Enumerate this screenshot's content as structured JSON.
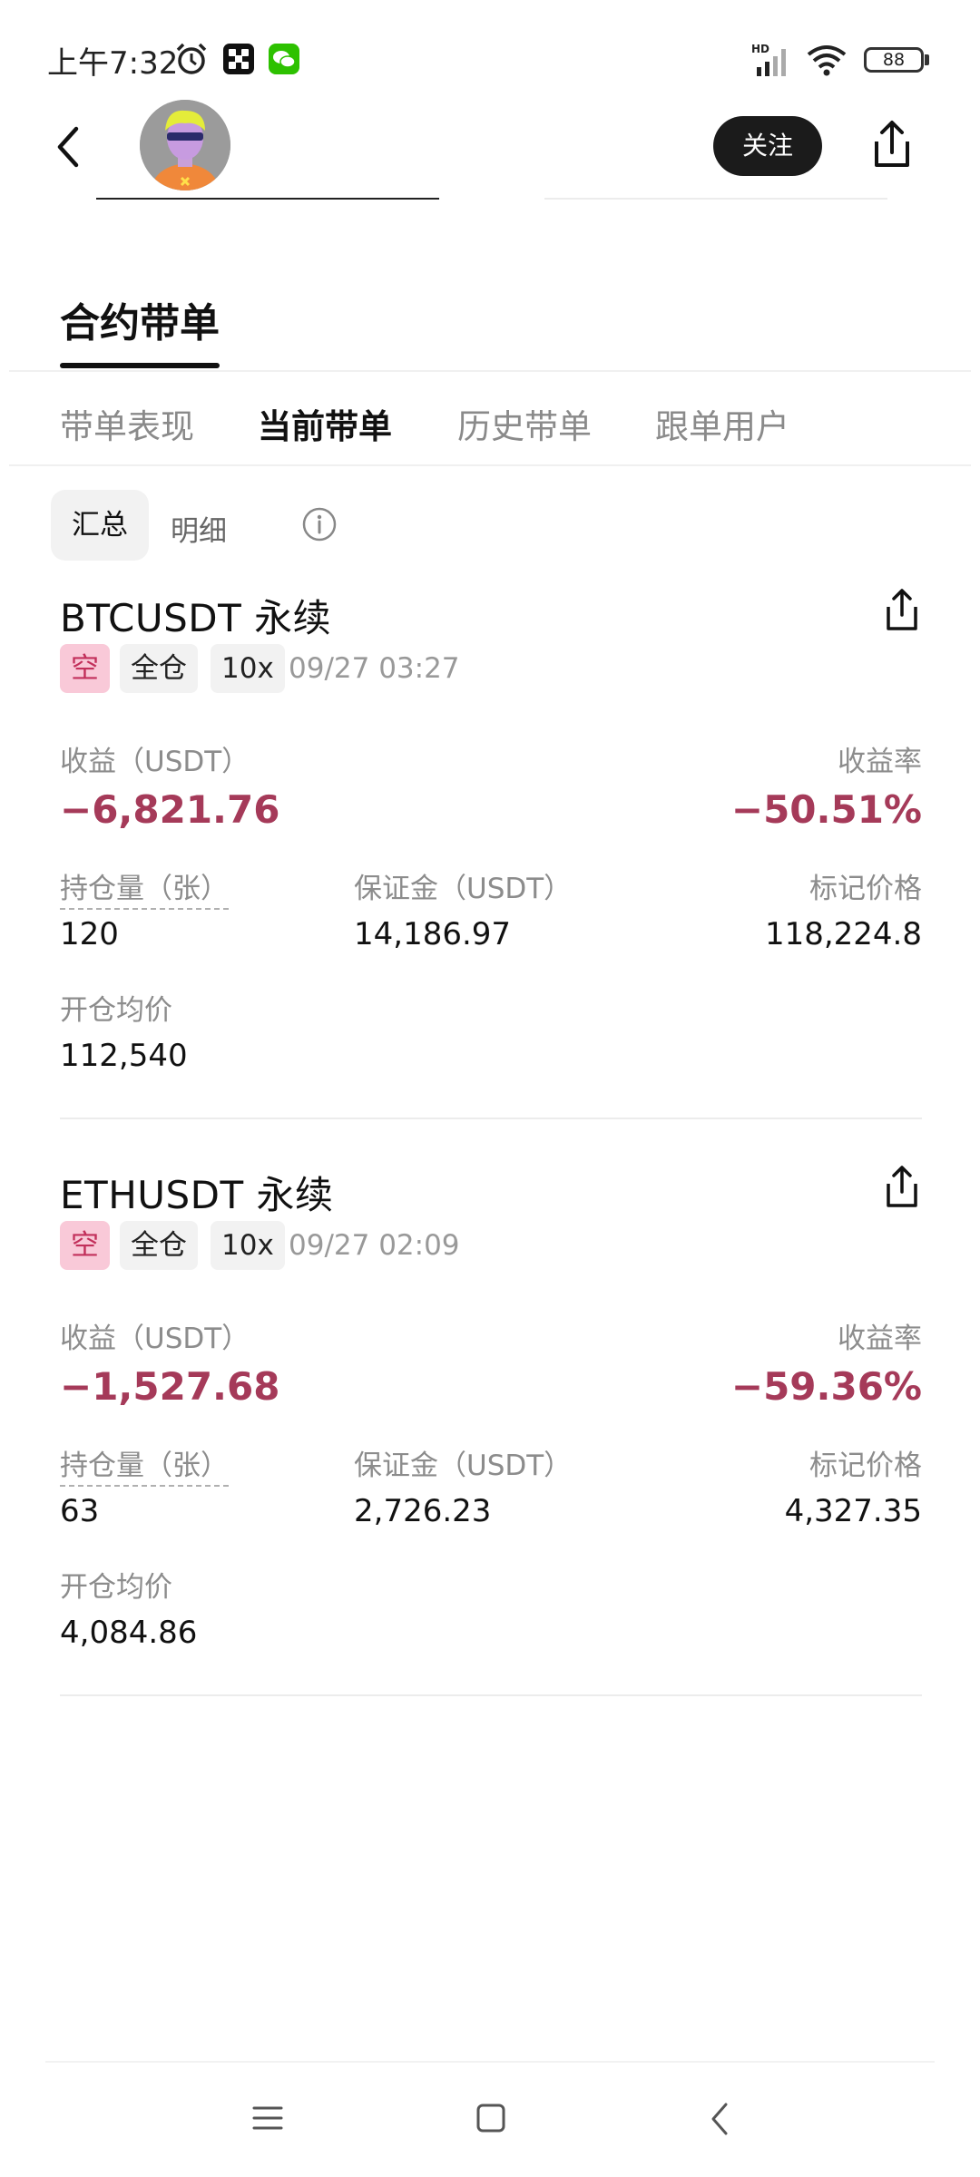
{
  "status_bar": {
    "time": "上午7:32",
    "hd": "HD",
    "battery": "88"
  },
  "header": {
    "follow_label": "关注"
  },
  "section": {
    "title": "合约带单"
  },
  "tabs": [
    {
      "label": "带单表现",
      "active": false
    },
    {
      "label": "当前带单",
      "active": true
    },
    {
      "label": "历史带单",
      "active": false
    },
    {
      "label": "跟单用户",
      "active": false
    }
  ],
  "segmented": {
    "summary": "汇总",
    "detail": "明细"
  },
  "positions": [
    {
      "pair": "BTCUSDT 永续",
      "direction": "空",
      "margin_mode": "全仓",
      "leverage": "10x",
      "open_time": "09/27 03:27",
      "pnl_label": "收益（USDT）",
      "pnl_value": "−6,821.76",
      "roi_label": "收益率",
      "roi_value": "−50.51%",
      "size_label": "持仓量（张）",
      "size_value": "120",
      "margin_label": "保证金（USDT）",
      "margin_value": "14,186.97",
      "mark_label": "标记价格",
      "mark_value": "118,224.8",
      "avg_label": "开仓均价",
      "avg_value": "112,540"
    },
    {
      "pair": "ETHUSDT 永续",
      "direction": "空",
      "margin_mode": "全仓",
      "leverage": "10x",
      "open_time": "09/27 02:09",
      "pnl_label": "收益（USDT）",
      "pnl_value": "−1,527.68",
      "roi_label": "收益率",
      "roi_value": "−59.36%",
      "size_label": "持仓量（张）",
      "size_value": "63",
      "margin_label": "保证金（USDT）",
      "margin_value": "2,726.23",
      "mark_label": "标记价格",
      "mark_value": "4,327.35",
      "avg_label": "开仓均价",
      "avg_value": "4,084.86"
    }
  ],
  "colors": {
    "negative": "#a53a59",
    "short_tag_bg": "#f9c9d8",
    "follow_button_bg": "#1b1b1b"
  },
  "icons": [
    "alarm-icon",
    "okx-app-icon",
    "wechat-icon",
    "signal-icon",
    "wifi-icon",
    "battery-icon",
    "back-icon",
    "share-icon",
    "info-icon",
    "nav-menu-icon",
    "nav-home-icon",
    "nav-back-icon"
  ]
}
